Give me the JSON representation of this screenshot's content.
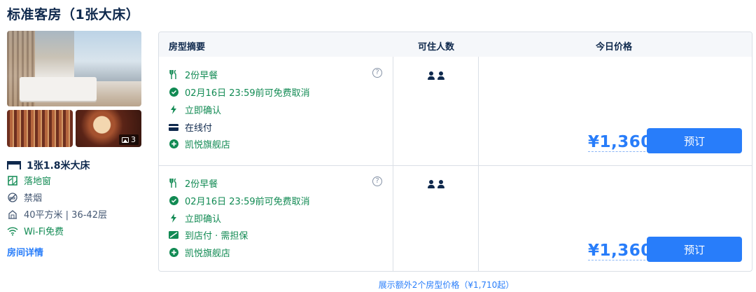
{
  "room": {
    "title": "标准客房（1张大床）",
    "photo_count": "3",
    "bed": "1张1.8米大床",
    "features": [
      {
        "icon": "window-icon",
        "label": "落地窗",
        "color": "green"
      },
      {
        "icon": "no-smoking-icon",
        "label": "禁烟",
        "color": "grey"
      },
      {
        "icon": "area-icon",
        "label": "40平方米 | 36-42层",
        "color": "grey"
      },
      {
        "icon": "wifi-icon",
        "label": "Wi-Fi免费",
        "color": "green"
      }
    ],
    "detail_link": "房间详情"
  },
  "table": {
    "headers": {
      "summary": "房型摘要",
      "guests": "可住人数",
      "price": "今日价格"
    },
    "rows": [
      {
        "policies": [
          {
            "icon": "dining-icon",
            "label": "2份早餐",
            "color": "green"
          },
          {
            "icon": "check-circle-icon",
            "label": "02月16日 23:59前可免费取消",
            "color": "green"
          },
          {
            "icon": "lightning-icon",
            "label": "立即确认",
            "color": "green"
          },
          {
            "icon": "card-icon",
            "label": "在线付",
            "color": "dark"
          },
          {
            "icon": "store-icon",
            "label": "凯悦旗舰店",
            "color": "green"
          }
        ],
        "guests": 2,
        "price": "¥1,360",
        "button": "预订"
      },
      {
        "policies": [
          {
            "icon": "dining-icon",
            "label": "2份早餐",
            "color": "green"
          },
          {
            "icon": "check-circle-icon",
            "label": "02月16日 23:59前可免费取消",
            "color": "green"
          },
          {
            "icon": "lightning-icon",
            "label": "立即确认",
            "color": "green"
          },
          {
            "icon": "pay-at-hotel-icon",
            "label": "到店付 · 需担保",
            "color": "green"
          },
          {
            "icon": "store-icon",
            "label": "凯悦旗舰店",
            "color": "green"
          }
        ],
        "guests": 2,
        "price": "¥1,360",
        "button": "预订"
      }
    ]
  },
  "more_link": "展示额外2个房型价格（¥1,710起）",
  "colors": {
    "accent": "#287dfa",
    "green": "#118a53",
    "text": "#0f294d",
    "grey": "#455873"
  }
}
